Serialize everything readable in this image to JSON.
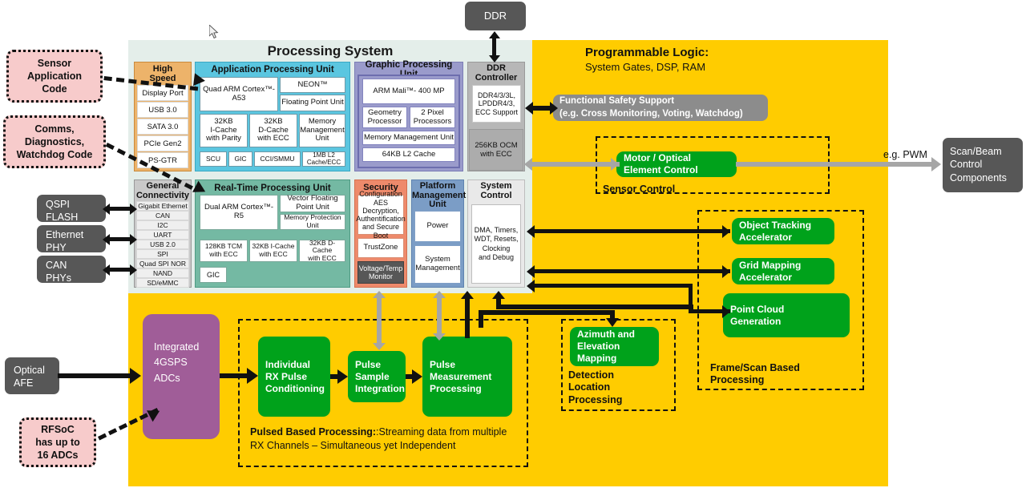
{
  "external": {
    "ddr": "DDR",
    "scan_beam": "Scan/Beam\nControl\nComponents",
    "scan_beam_lines": [
      "Scan/Beam",
      "Control",
      "Components"
    ],
    "pwm_label": "e.g. PWM",
    "optical_afe_lines": [
      "Optical",
      "AFE"
    ],
    "left_phys": [
      {
        "name": "qspi-flash",
        "lines": [
          "QSPI",
          "FLASH"
        ]
      },
      {
        "name": "ethernet-phy",
        "lines": [
          "Ethernet",
          "PHY"
        ]
      },
      {
        "name": "can-phys",
        "lines": [
          "CAN",
          "PHYs"
        ]
      }
    ]
  },
  "callouts": [
    {
      "name": "sensor-application-code",
      "lines": [
        "Sensor",
        "Application",
        "Code"
      ]
    },
    {
      "name": "comms-diagnostics-watchdog-code",
      "lines": [
        "Comms,",
        "Diagnostics,",
        "Watchdog Code"
      ]
    },
    {
      "name": "rfsoc-adcs",
      "lines": [
        "RFSoC",
        "has up to",
        "16 ADCs"
      ]
    }
  ],
  "processing_system": {
    "title": "Processing System",
    "high_speed": {
      "header": "High\nSpeed",
      "header_lines": [
        "High",
        "Speed"
      ],
      "items": [
        "Display Port",
        "USB 3.0",
        "SATA 3.0",
        "PCIe Gen2",
        "PS-GTR"
      ]
    },
    "general_connectivity": {
      "header_lines": [
        "General",
        "Connectivity"
      ],
      "items": [
        "Gigabit Ethernet",
        "CAN",
        "I2C",
        "UART",
        "USB 2.0",
        "SPI",
        "Quad SPI NOR",
        "NAND",
        "SD/eMMC"
      ]
    },
    "apu": {
      "header": "Application Processing Unit",
      "core": "Quad ARM Cortex™-A53",
      "neon": "NEON™",
      "fpu": "Floating Point Unit",
      "caches": [
        [
          "32KB",
          "I-Cache",
          "with Parity"
        ],
        [
          "32KB",
          "D-Cache",
          "with ECC"
        ],
        [
          "Memory",
          "Management",
          "Unit"
        ]
      ],
      "bottom": [
        "SCU",
        "GIC",
        "CCI/SMMU",
        "1MB L2 Cache/ECC"
      ]
    },
    "rpu": {
      "header": "Real-Time Processing Unit",
      "core": "Dual ARM Cortex™-R5",
      "vfpu_lines": [
        "Vector Floating",
        "Point Unit"
      ],
      "mpu_lines": [
        "Memory Protection",
        "Unit"
      ],
      "caches": [
        [
          "128KB TCM",
          "with ECC"
        ],
        [
          "32KB I-Cache",
          "with ECC"
        ],
        [
          "32KB D-Cache",
          "with ECC"
        ]
      ],
      "gic": "GIC"
    },
    "gpu": {
      "header": "Graphic Processing Unit",
      "mali": "ARM Mali™- 400 MP",
      "geometry_lines": [
        "Geometry",
        "Processor"
      ],
      "pixel_lines": [
        "2 Pixel",
        "Processors"
      ],
      "mmu": "Memory Management Unit",
      "l2": "64KB L2 Cache"
    },
    "ddr_controller": {
      "header_lines": [
        "DDR",
        "Controller"
      ],
      "spec_lines": [
        "DDR4/3/3L,",
        "LPDDR4/3,",
        "ECC Support"
      ],
      "ocm_lines": [
        "256KB OCM",
        "with ECC"
      ]
    },
    "security": {
      "header": "Security",
      "config_lines": [
        "Configuration",
        "AES Decryption,",
        "Authentification",
        "and Secure Boot"
      ],
      "trustzone": "TrustZone",
      "monitor_lines": [
        "Voltage/Temp",
        "Monitor"
      ]
    },
    "pmu": {
      "header_lines": [
        "Platform",
        "Management",
        "Unit"
      ],
      "power": "Power",
      "system_management_lines": [
        "System",
        "Management"
      ]
    },
    "system_control": {
      "header_lines": [
        "System",
        "Control"
      ],
      "detail_lines": [
        "DMA, Timers,",
        "WDT, Resets,",
        "Clocking",
        "and Debug"
      ]
    }
  },
  "programmable_logic": {
    "title": "Programmable Logic:",
    "subtitle": "System Gates, DSP, RAM",
    "functional_safety": {
      "line1": "Functional Safety Support",
      "line2": "(e.g. Cross Monitoring, Voting, Watchdog)"
    },
    "sensor_control": {
      "group_label": "Sensor Control",
      "block_lines": [
        "Motor / Optical",
        "Element Control"
      ]
    },
    "frame_scan": {
      "group_label_lines": [
        "Frame/Scan Based",
        "Processing"
      ],
      "blocks": [
        {
          "name": "object-tracking-accelerator",
          "lines": [
            "Object Tracking",
            "Accelerator"
          ]
        },
        {
          "name": "grid-mapping-accelerator",
          "lines": [
            "Grid Mapping",
            "Accelerator"
          ]
        },
        {
          "name": "point-cloud-generation",
          "lines": [
            "Point Cloud",
            "Generation"
          ]
        }
      ]
    },
    "detection_location": {
      "group_label_lines": [
        "Detection",
        "Location",
        "Processing"
      ],
      "block_lines": [
        "Azimuth and",
        "Elevation",
        "Mapping"
      ]
    },
    "pulsed_processing": {
      "caption_bold": "Pulsed Based Processing:",
      "caption_rest": ":Streaming data from multiple RX Channels – Simultaneous yet Independent",
      "blocks": [
        {
          "name": "individual-rx-pulse-conditioning",
          "lines": [
            "Individual",
            "RX Pulse",
            "Conditioning"
          ]
        },
        {
          "name": "pulse-sample-integration",
          "lines": [
            "Pulse",
            "Sample",
            "Integration"
          ]
        },
        {
          "name": "pulse-measurement-processing",
          "lines": [
            "Pulse",
            "Measurement",
            "Processing"
          ]
        }
      ]
    },
    "adc": {
      "lines": [
        "Integrated",
        "4GSPS",
        "ADCs"
      ]
    }
  },
  "colors": {
    "pl_yellow": "#FFCC00",
    "green": "#00A21B",
    "purple": "#A05D98",
    "gray_box": "#575757",
    "pink": "#F7CBCB",
    "apu_blue": "#5BC6E0",
    "rpu_teal": "#74B9A3",
    "gpu_violet": "#9A9BCB",
    "highspeed_orange": "#EDB36A",
    "security_orange": "#EE8A6B",
    "pmu_blue": "#7B9DC6"
  }
}
